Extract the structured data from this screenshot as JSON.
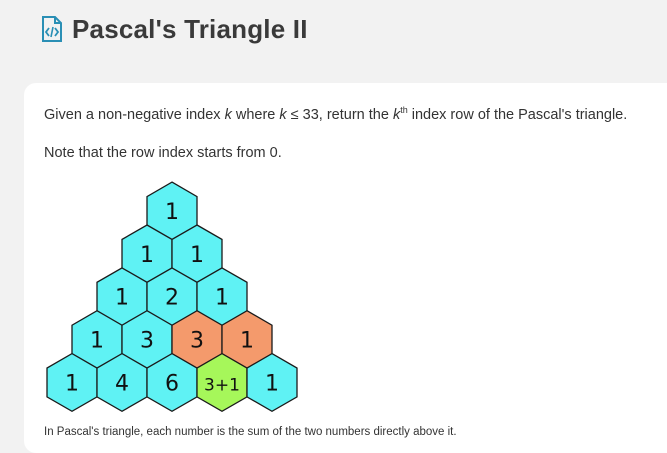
{
  "header": {
    "title": "Pascal's Triangle II"
  },
  "problem": {
    "desc_pre": "Given a non-negative index ",
    "k1": "k",
    "desc_mid": " where ",
    "k2": "k",
    "leq": " ≤ 33, return the ",
    "k3": "k",
    "th": "th",
    "desc_post": " index row of the Pascal's triangle.",
    "note": "Note that the row index starts from 0.",
    "caption": "In Pascal's triangle, each number is the sum of the two numbers directly above it."
  },
  "triangle": {
    "rows": [
      [
        "1"
      ],
      [
        "1",
        "1"
      ],
      [
        "1",
        "2",
        "1"
      ],
      [
        "1",
        "3",
        "3",
        "1"
      ],
      [
        "1",
        "4",
        "6",
        "3+1",
        "1"
      ]
    ],
    "highlight": {
      "3-2": "orange",
      "3-3": "orange",
      "4-3": "green"
    },
    "colors": {
      "cyan": "#5ff2f4",
      "orange": "#f49a6c",
      "green": "#a6f75a",
      "stroke": "#1a1a1a"
    }
  }
}
